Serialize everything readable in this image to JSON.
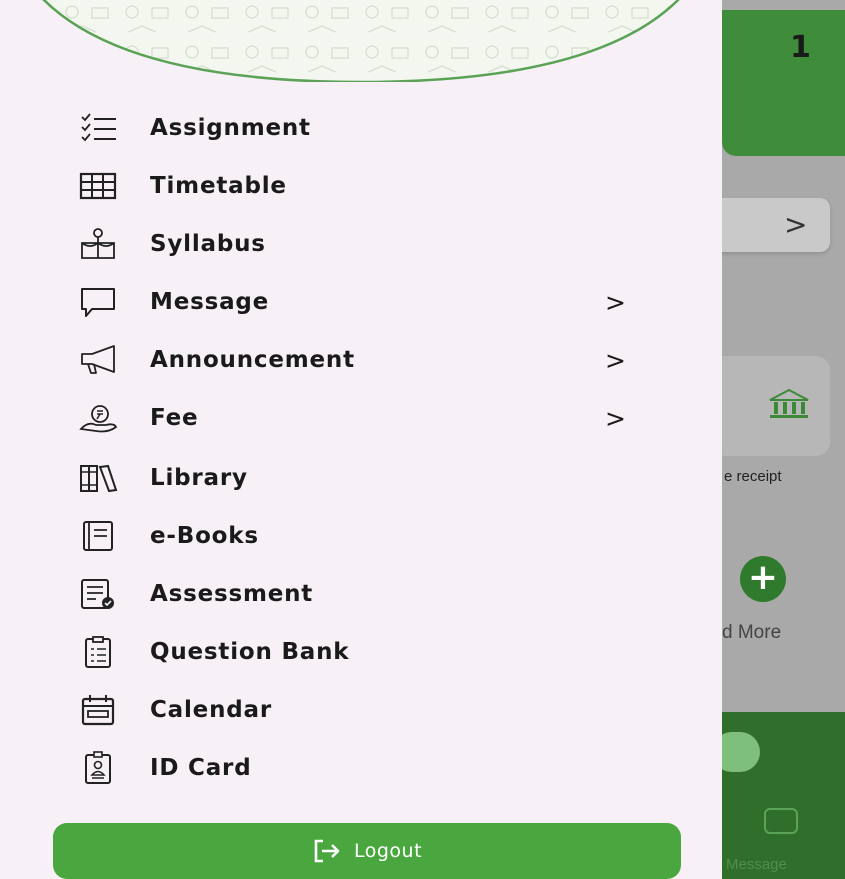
{
  "background": {
    "count": "1",
    "chevron": ">",
    "receipt_label": "e receipt",
    "add_label": "d More",
    "message_label": "Message"
  },
  "drawer": {
    "items": [
      {
        "label": "Assignment",
        "icon": "checklist-icon",
        "chevron": ""
      },
      {
        "label": "Timetable",
        "icon": "table-grid-icon",
        "chevron": ""
      },
      {
        "label": "Syllabus",
        "icon": "syllabus-icon",
        "chevron": ""
      },
      {
        "label": "Message",
        "icon": "chat-bubble-icon",
        "chevron": ">"
      },
      {
        "label": "Announcement",
        "icon": "megaphone-icon",
        "chevron": ">"
      },
      {
        "label": "Fee",
        "icon": "money-icon",
        "chevron": ">"
      },
      {
        "label": "Library",
        "icon": "books-icon",
        "chevron": ""
      },
      {
        "label": "e-Books",
        "icon": "ebook-icon",
        "chevron": ""
      },
      {
        "label": "Assessment",
        "icon": "assessment-icon",
        "chevron": ""
      },
      {
        "label": "Question Bank",
        "icon": "clipboard-icon",
        "chevron": ""
      },
      {
        "label": "Calendar",
        "icon": "calendar-icon",
        "chevron": ""
      },
      {
        "label": "ID Card",
        "icon": "id-card-icon",
        "chevron": ""
      }
    ],
    "logout_label": "Logout"
  },
  "colors": {
    "accent": "#4aa73f",
    "drawer_bg": "#f7f0f6",
    "header_border": "#5aa356"
  }
}
